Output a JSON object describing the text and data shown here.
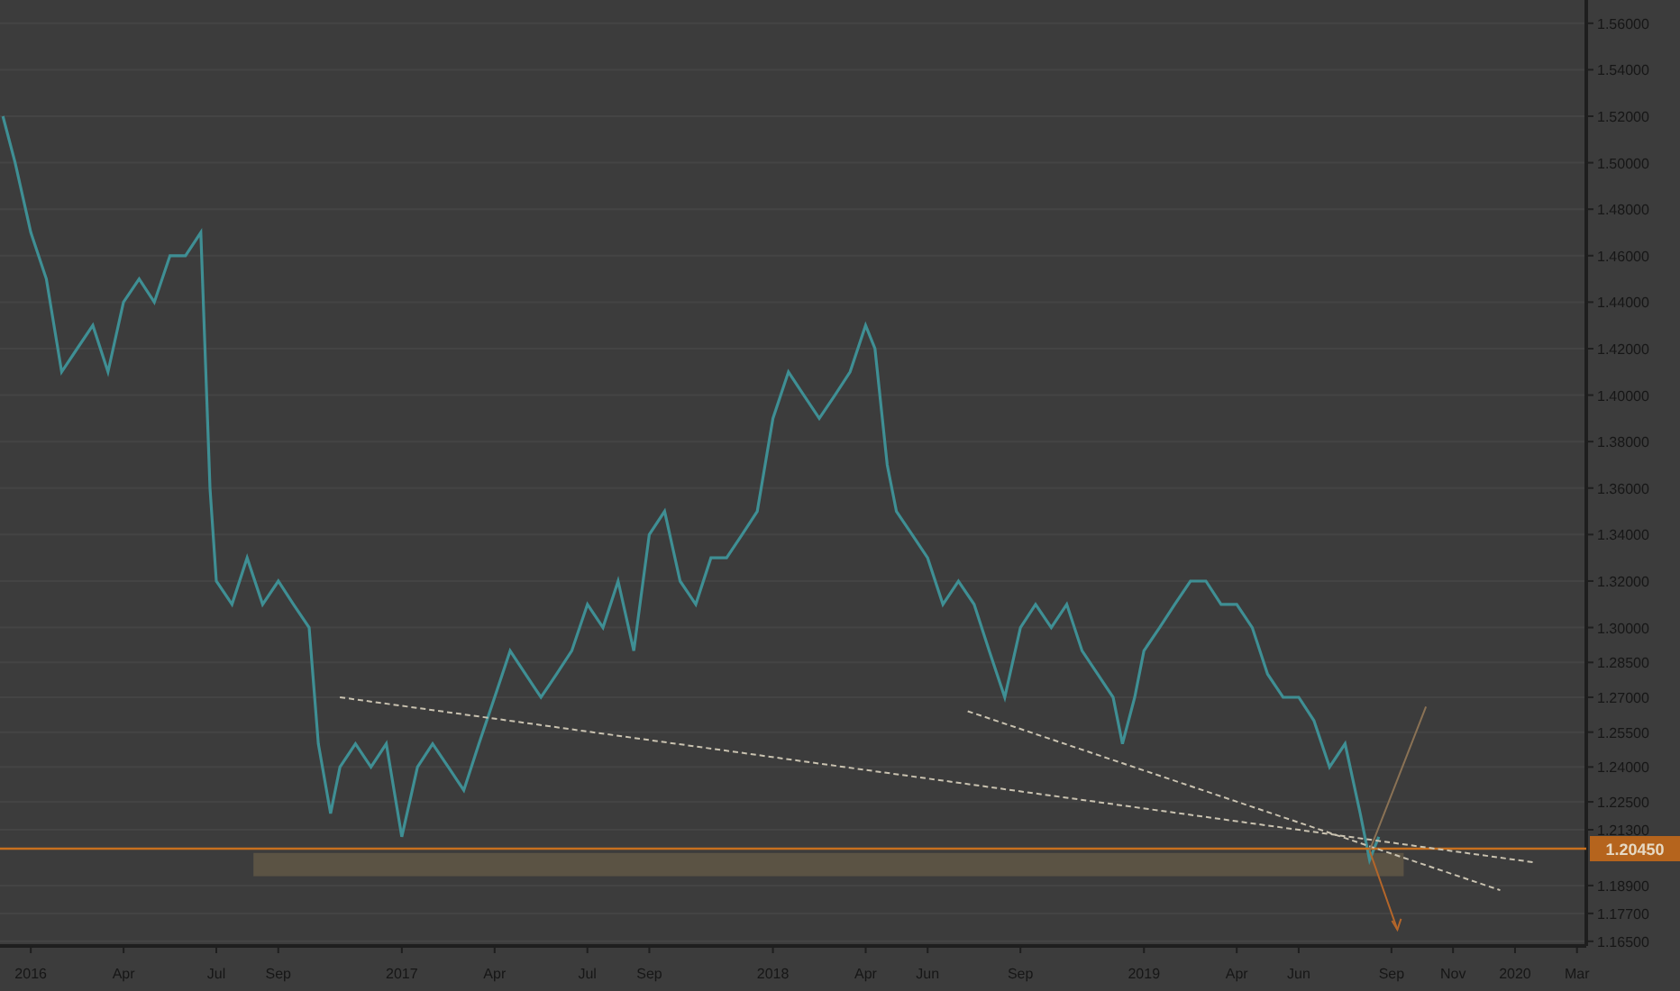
{
  "chart_data": {
    "type": "line",
    "x": [
      2015.925,
      2015.958,
      2016,
      2016.042,
      2016.083,
      2016.125,
      2016.167,
      2016.208,
      2016.25,
      2016.292,
      2016.333,
      2016.375,
      2016.417,
      2016.458,
      2016.483,
      2016.5,
      2016.542,
      2016.583,
      2016.625,
      2016.667,
      2016.708,
      2016.75,
      2016.775,
      2016.808,
      2016.833,
      2016.875,
      2016.917,
      2016.958,
      2017,
      2017.042,
      2017.083,
      2017.125,
      2017.167,
      2017.208,
      2017.25,
      2017.292,
      2017.333,
      2017.375,
      2017.417,
      2017.458,
      2017.5,
      2017.542,
      2017.583,
      2017.625,
      2017.667,
      2017.708,
      2017.75,
      2017.792,
      2017.833,
      2017.875,
      2017.917,
      2017.958,
      2018,
      2018.042,
      2018.083,
      2018.125,
      2018.167,
      2018.208,
      2018.25,
      2018.275,
      2018.308,
      2018.333,
      2018.375,
      2018.417,
      2018.458,
      2018.5,
      2018.542,
      2018.583,
      2018.625,
      2018.667,
      2018.708,
      2018.75,
      2018.792,
      2018.833,
      2018.875,
      2018.917,
      2018.942,
      2018.975,
      2019,
      2019.042,
      2019.083,
      2019.125,
      2019.167,
      2019.208,
      2019.25,
      2019.292,
      2019.333,
      2019.375,
      2019.417,
      2019.458,
      2019.5,
      2019.542,
      2019.583,
      2019.608,
      2019.633
    ],
    "series": [
      {
        "color": "#3f8f94",
        "values": [
          1.52,
          1.5,
          1.47,
          1.45,
          1.41,
          1.42,
          1.43,
          1.41,
          1.44,
          1.45,
          1.44,
          1.46,
          1.46,
          1.47,
          1.36,
          1.32,
          1.31,
          1.33,
          1.31,
          1.32,
          1.31,
          1.3,
          1.25,
          1.22,
          1.24,
          1.25,
          1.24,
          1.25,
          1.21,
          1.24,
          1.25,
          1.24,
          1.23,
          1.25,
          1.27,
          1.29,
          1.28,
          1.27,
          1.28,
          1.29,
          1.31,
          1.3,
          1.32,
          1.29,
          1.34,
          1.35,
          1.32,
          1.31,
          1.33,
          1.33,
          1.34,
          1.35,
          1.39,
          1.41,
          1.4,
          1.39,
          1.4,
          1.41,
          1.43,
          1.42,
          1.37,
          1.35,
          1.34,
          1.33,
          1.31,
          1.32,
          1.31,
          1.29,
          1.27,
          1.3,
          1.31,
          1.3,
          1.31,
          1.29,
          1.28,
          1.27,
          1.25,
          1.27,
          1.29,
          1.3,
          1.31,
          1.32,
          1.32,
          1.31,
          1.31,
          1.3,
          1.28,
          1.27,
          1.27,
          1.26,
          1.24,
          1.25,
          1.22,
          1.2,
          1.21
        ]
      }
    ],
    "xlim": [
      2015.917,
      2020.192
    ],
    "ylim": [
      1.163,
      1.57
    ],
    "xticks": [
      {
        "value": 2016,
        "label": "2016"
      },
      {
        "value": 2016.25,
        "label": "Apr"
      },
      {
        "value": 2016.5,
        "label": "Jul"
      },
      {
        "value": 2016.667,
        "label": "Sep"
      },
      {
        "value": 2017,
        "label": "2017"
      },
      {
        "value": 2017.25,
        "label": "Apr"
      },
      {
        "value": 2017.5,
        "label": "Jul"
      },
      {
        "value": 2017.667,
        "label": "Sep"
      },
      {
        "value": 2018,
        "label": "2018"
      },
      {
        "value": 2018.25,
        "label": "Apr"
      },
      {
        "value": 2018.417,
        "label": "Jun"
      },
      {
        "value": 2018.667,
        "label": "Sep"
      },
      {
        "value": 2019,
        "label": "2019"
      },
      {
        "value": 2019.25,
        "label": "Apr"
      },
      {
        "value": 2019.417,
        "label": "Jun"
      },
      {
        "value": 2019.667,
        "label": "Sep"
      },
      {
        "value": 2019.833,
        "label": "Nov"
      },
      {
        "value": 2020,
        "label": "2020"
      },
      {
        "value": 2020.167,
        "label": "Mar"
      }
    ],
    "yticks": [
      {
        "value": 1.56,
        "label": "1.56000"
      },
      {
        "value": 1.54,
        "label": "1.54000"
      },
      {
        "value": 1.52,
        "label": "1.52000"
      },
      {
        "value": 1.5,
        "label": "1.50000"
      },
      {
        "value": 1.48,
        "label": "1.48000"
      },
      {
        "value": 1.46,
        "label": "1.46000"
      },
      {
        "value": 1.44,
        "label": "1.44000"
      },
      {
        "value": 1.42,
        "label": "1.42000"
      },
      {
        "value": 1.4,
        "label": "1.40000"
      },
      {
        "value": 1.38,
        "label": "1.38000"
      },
      {
        "value": 1.36,
        "label": "1.36000"
      },
      {
        "value": 1.34,
        "label": "1.34000"
      },
      {
        "value": 1.32,
        "label": "1.32000"
      },
      {
        "value": 1.3,
        "label": "1.30000"
      },
      {
        "value": 1.285,
        "label": "1.28500"
      },
      {
        "value": 1.27,
        "label": "1.27000"
      },
      {
        "value": 1.255,
        "label": "1.25500"
      },
      {
        "value": 1.24,
        "label": "1.24000"
      },
      {
        "value": 1.225,
        "label": "1.22500"
      },
      {
        "value": 1.213,
        "label": "1.21300"
      },
      {
        "value": 1.189,
        "label": "1.18900"
      },
      {
        "value": 1.177,
        "label": "1.17700"
      },
      {
        "value": 1.165,
        "label": "1.16500"
      }
    ],
    "grid": true
  },
  "price_tag": {
    "label": "1.20450"
  }
}
